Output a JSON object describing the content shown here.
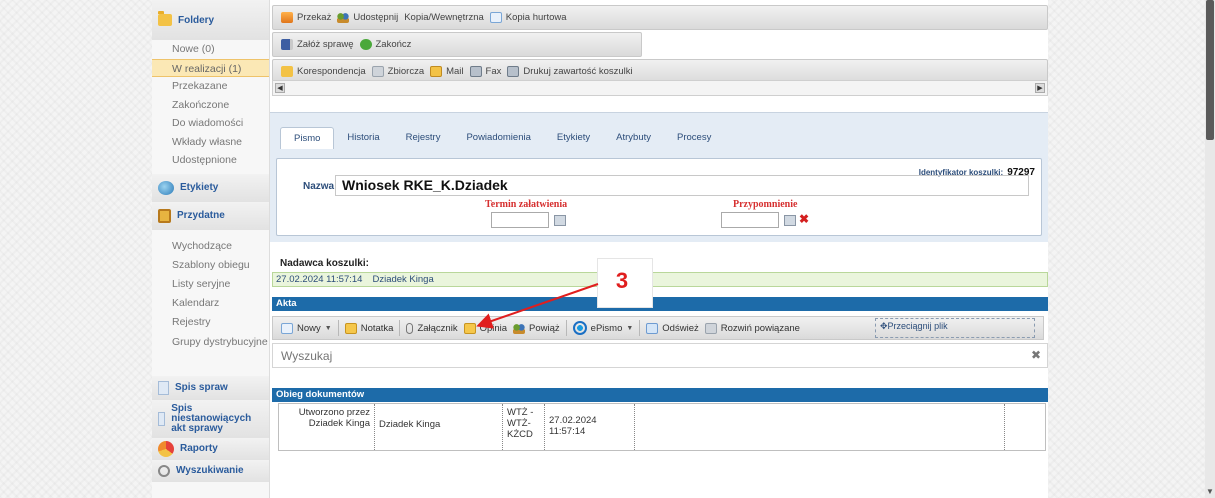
{
  "sidebar": {
    "folders_title": "Foldery",
    "items": [
      {
        "label": "Nowe (0)"
      },
      {
        "label": "W realizacji (1)"
      },
      {
        "label": "Przekazane"
      },
      {
        "label": "Zakończone"
      },
      {
        "label": "Do wiadomości"
      },
      {
        "label": "Wkłady własne"
      },
      {
        "label": "Udostępnione"
      }
    ],
    "labels_title": "Etykiety",
    "useful_title": "Przydatne",
    "useful_items": [
      {
        "label": "Wychodzące"
      },
      {
        "label": "Szablony obiegu"
      },
      {
        "label": "Listy seryjne"
      },
      {
        "label": "Kalendarz"
      },
      {
        "label": "Rejestry"
      },
      {
        "label": "Grupy dystrybucyjne"
      }
    ],
    "cases_title": "Spis spraw",
    "noncases_title": "Spis niestanowiących akt sprawy",
    "reports_title": "Raporty",
    "search_title": "Wyszukiwanie"
  },
  "toolbar1": {
    "przekaz": "Przekaż",
    "udostepnij": "Udostępnij",
    "kopia": "Kopia/Wewnętrzna",
    "kopia_hurtowa": "Kopia hurtowa"
  },
  "toolbar2": {
    "zaloz": "Załóż sprawę",
    "zakoncz": "Zakończ"
  },
  "toolbar3": {
    "korespondencja": "Korespondencja",
    "zbiorcza": "Zbiorcza",
    "mail": "Mail",
    "fax": "Fax",
    "drukuj": "Drukuj zawartość koszulki"
  },
  "tabs": [
    {
      "label": "Pismo"
    },
    {
      "label": "Historia"
    },
    {
      "label": "Rejestry"
    },
    {
      "label": "Powiadomienia"
    },
    {
      "label": "Etykiety"
    },
    {
      "label": "Atrybuty"
    },
    {
      "label": "Procesy"
    }
  ],
  "form": {
    "id_label": "Identyfikator koszulki:",
    "id_value": "97297",
    "name_label": "Nazwa",
    "name_value": "Wniosek RKE_K.Dziadek",
    "due_label": "Termin załatwienia",
    "reminder_label": "Przypomnienie"
  },
  "sender": {
    "label": "Nadawca koszulki:",
    "datetime": "27.02.2024 11:57:14",
    "name": "Dziadek Kinga"
  },
  "akta": {
    "title": "Akta",
    "nowy": "Nowy",
    "notatka": "Notatka",
    "zalacznik": "Załącznik",
    "opinia": "Opinia",
    "powiaz": "Powiąż",
    "epismo": "ePismo",
    "odswiez": "Odśwież",
    "rozwin": "Rozwiń powiązane",
    "drag": "Przeciągnij plik"
  },
  "search": {
    "placeholder": "Wyszukaj"
  },
  "flow": {
    "title": "Obieg dokumentów",
    "c1": "Utworzono przez Dziadek Kinga",
    "c2": "Dziadek Kinga",
    "c3": "WTŻ - WTŻ-KŻCD",
    "c4": "27.02.2024 11:57:14"
  },
  "annotation": {
    "number": "3",
    "color": "#e01e1e"
  }
}
